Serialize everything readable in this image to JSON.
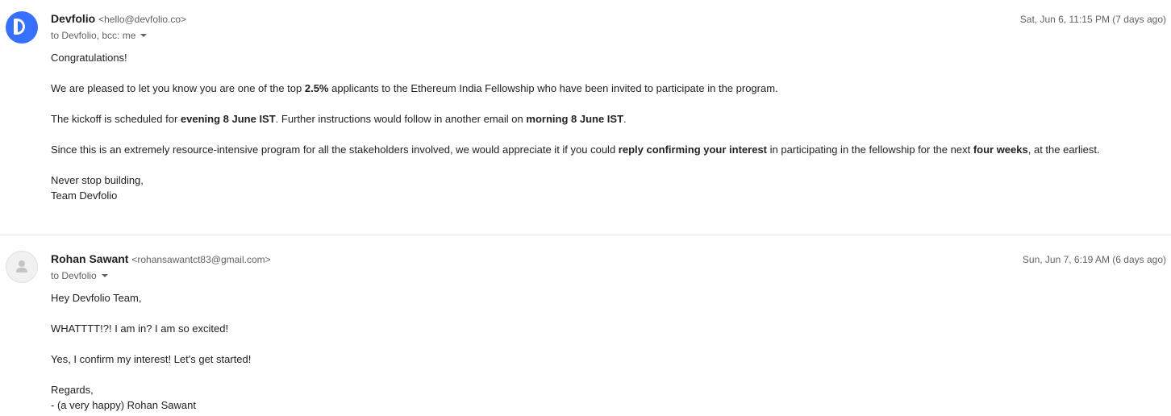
{
  "messages": [
    {
      "sender_name": "Devfolio",
      "sender_email": "<hello@devfolio.co>",
      "recipients": "to Devfolio, bcc: me",
      "date": "Sat, Jun 6, 11:15 PM (7 days ago)",
      "avatar": "devfolio-logo-icon",
      "avatar_color": "#3770ff",
      "body": {
        "greeting": "Congratulations!",
        "p1_a": "We are pleased to let you know you are one of the top ",
        "p1_b": "2.5%",
        "p1_c": " applicants to the Ethereum India Fellowship who have been invited to participate in the program.",
        "p2_a": "The kickoff is scheduled for ",
        "p2_b": "evening  8 June IST",
        "p2_c": ". Further instructions would follow in another email on ",
        "p2_d": "morning  8 June IST",
        "p2_e": ".",
        "p3_a": "Since this is an extremely resource-intensive program for all the stakeholders involved, we would appreciate it if you could ",
        "p3_b": "reply confirming your interest",
        "p3_c": " in participating in the fellowship for the next ",
        "p3_d": "four weeks",
        "p3_e": ", at the earliest.",
        "signoff_1": "Never stop building,",
        "signoff_2": "Team Devfolio"
      }
    },
    {
      "sender_name": "Rohan Sawant",
      "sender_email": "<rohansawantct83@gmail.com>",
      "recipients": "to Devfolio",
      "date": "Sun, Jun 7, 6:19 AM (6 days ago)",
      "avatar": "default-person-icon",
      "body": {
        "greeting": "Hey Devfolio Team,",
        "p1": "WHATTTT!?! I am in? I am so excited!",
        "p2": "Yes, I confirm my interest! Let's get started!",
        "signoff_1": "Regards,",
        "signoff_2": "- (a very happy) Rohan Sawant"
      }
    }
  ]
}
